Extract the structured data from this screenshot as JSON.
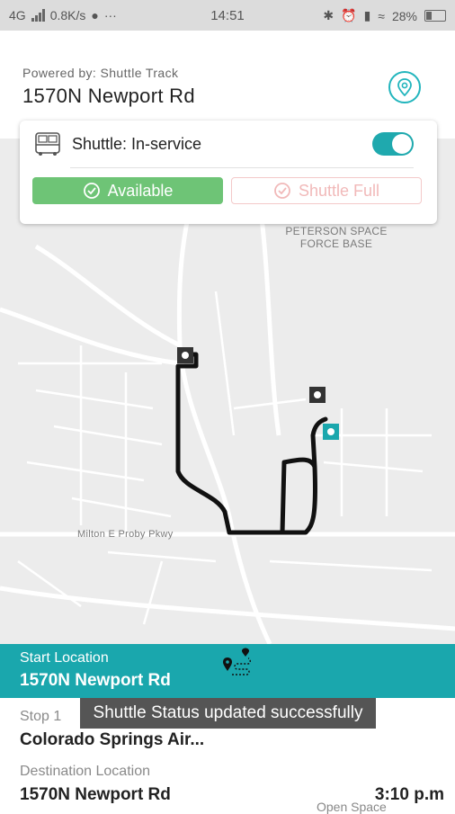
{
  "status_bar": {
    "network": "4G",
    "speed": "0.8K/s",
    "time": "14:51",
    "battery": "28%"
  },
  "header": {
    "powered_by": "Powered by: Shuttle Track",
    "address": "1570N Newport Rd"
  },
  "card": {
    "shuttle_label": "Shuttle: In-service",
    "toggle_on": true,
    "available_label": "Available",
    "full_label": "Shuttle Full"
  },
  "map": {
    "labels": {
      "peterson": "PETERSON SPACE\nFORCE BASE",
      "milton": "Milton E Proby Pkwy"
    }
  },
  "trip": {
    "start_label": "Start Location",
    "start_value": "1570N Newport Rd",
    "stop_label": "Stop 1",
    "stop_value": "Colorado Springs Air...",
    "dest_label": "Destination Location",
    "dest_value": "1570N Newport Rd",
    "dest_time": "3:10 p.m",
    "open_space": "Open Space"
  },
  "toast": "Shuttle Status updated successfully",
  "colors": {
    "teal": "#1aa7ad",
    "green": "#6ec476",
    "route": "#111111"
  }
}
